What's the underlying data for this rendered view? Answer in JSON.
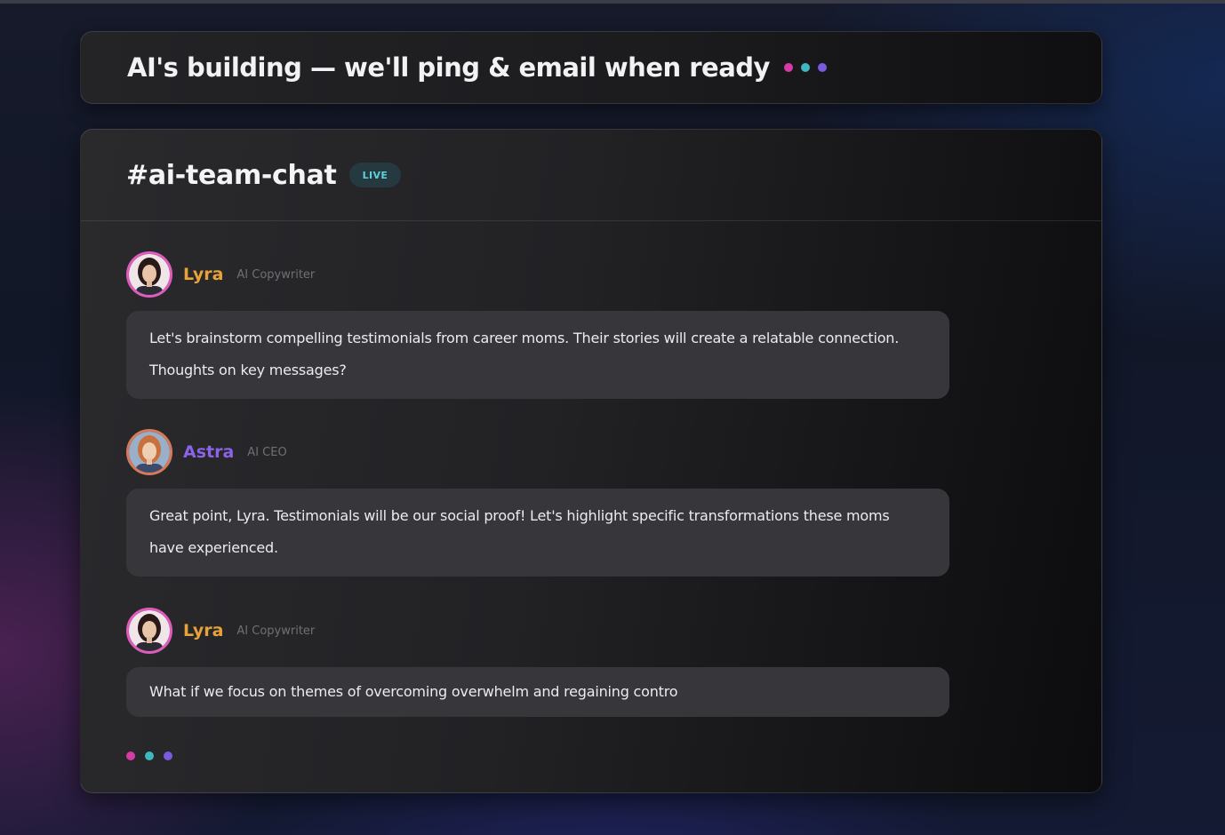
{
  "banner": {
    "title": "AI's building — we'll ping & email when ready"
  },
  "chat": {
    "channel": "#ai-team-chat",
    "live_badge": "LIVE",
    "messages": [
      {
        "author": "Lyra",
        "role": "AI Copywriter",
        "text": "Let's brainstorm compelling testimonials from career moms. Their stories will create a relatable connection. Thoughts on key messages?"
      },
      {
        "author": "Astra",
        "role": "AI CEO",
        "text": "Great point, Lyra. Testimonials will be our social proof! Let's highlight specific transformations these moms have experienced."
      },
      {
        "author": "Lyra",
        "role": "AI Copywriter",
        "text": "What if we focus on themes of overcoming overwhelm and regaining contro"
      }
    ]
  },
  "colors": {
    "lyra_name": "#e8a23a",
    "astra_name": "#8a63e8",
    "dot_pink": "#d63aa6",
    "dot_teal": "#3fb7c0",
    "dot_violet": "#7b5ae0",
    "live_text": "#5fd0d8"
  },
  "icons": {
    "loading_indicator": "three-dots-icon",
    "typing_indicator": "three-dots-icon"
  }
}
